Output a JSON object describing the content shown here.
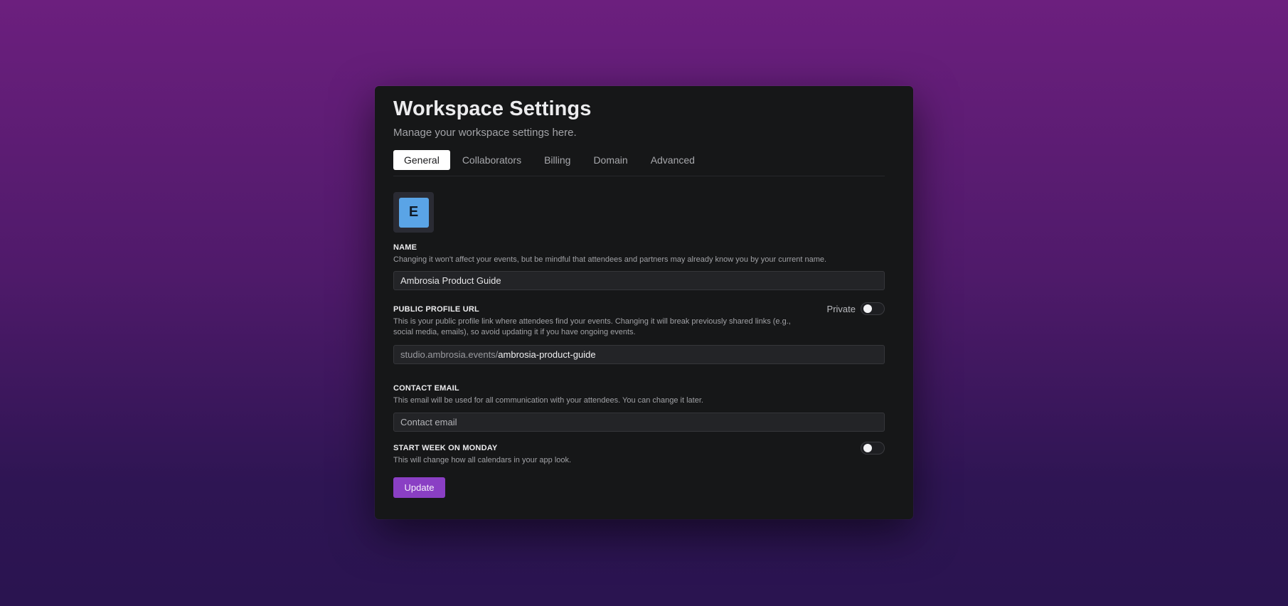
{
  "header": {
    "title": "Workspace Settings",
    "subtitle": "Manage your workspace settings here."
  },
  "tabs": [
    {
      "label": "General",
      "active": true
    },
    {
      "label": "Collaborators",
      "active": false
    },
    {
      "label": "Billing",
      "active": false
    },
    {
      "label": "Domain",
      "active": false
    },
    {
      "label": "Advanced",
      "active": false
    }
  ],
  "avatar": {
    "letter": "E",
    "color": "#5aa4e6"
  },
  "name_field": {
    "label": "NAME",
    "help": "Changing it won't affect your events, but be mindful that attendees and partners may already know you by your current name.",
    "value": "Ambrosia Product Guide"
  },
  "profile_url": {
    "label": "PUBLIC PROFILE URL",
    "help": "This is your public profile link where attendees find your events. Changing it will break previously shared links (e.g., social media, emails), so avoid updating it if you have ongoing events.",
    "prefix": "studio.ambrosia.events/",
    "slug": "ambrosia-product-guide",
    "private_label": "Private",
    "private_enabled": false
  },
  "contact_email": {
    "label": "CONTACT EMAIL",
    "help": "This email will be used for all communication with your attendees. You can change it later.",
    "placeholder": "Contact email",
    "value": ""
  },
  "start_week": {
    "label": "START WEEK ON MONDAY",
    "help": "This will change how all calendars in your app look.",
    "enabled": false
  },
  "actions": {
    "update_label": "Update"
  },
  "colors": {
    "accent": "#8a3fc4",
    "card_bg": "#161718",
    "bg_top": "#6c1f7e",
    "bg_bottom": "#2a1450"
  }
}
